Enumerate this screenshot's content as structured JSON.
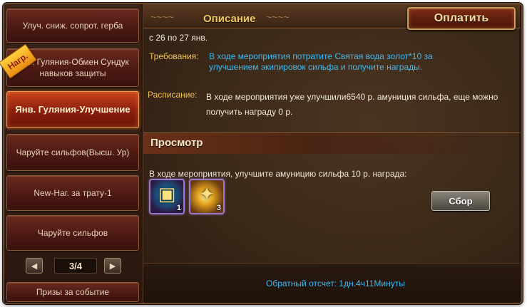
{
  "sidebar": {
    "items": [
      {
        "label": "Улуч. сниж. сопрот. герба"
      },
      {
        "label": "Янв. Гуляния-Обмен Сундук навыков защиты"
      },
      {
        "label": "Янв. Гуляния-Улучшение"
      },
      {
        "label": "Чаруйте сильфов(Высш. Ур)"
      },
      {
        "label": "New-Наг. за трату-1"
      },
      {
        "label": "Чаруйте сильфов"
      },
      {
        "label": "Призы за событие"
      }
    ],
    "badge": "Нагр.",
    "pager": {
      "prev": "◀",
      "next": "▶",
      "count": "3/4"
    }
  },
  "header": {
    "title": "Описание",
    "pay_button": "Оплатить"
  },
  "description": {
    "dates": "с 26 по 27 янв.",
    "requirements_label": "Требования:",
    "requirements_text": "В ходе мероприятия потратите Святая вода золот*10 за улучшением экипировок сильфа  и получите награды.",
    "schedule_label": "Расписание:",
    "schedule_text": "В ходе мероприятия уже улучшили6540 р. амуниция сильфа, еще можно получить награду 0 р."
  },
  "preview": {
    "title": "Просмотр",
    "text": "В ходе мероприятия, улучшите амуницию сильфа 10 р. награда:",
    "rewards": [
      {
        "icon": "treasure-chest-icon",
        "qty": "1"
      },
      {
        "icon": "golden-scroll-icon",
        "qty": "3"
      }
    ],
    "collect_button": "Сбор"
  },
  "footer": {
    "countdown": "Обратный отсчет: 1дн.4ч11Минуты"
  },
  "colors": {
    "accent_gold": "#f0c050",
    "link_blue": "#40b8f0",
    "active_red": "#c8401c"
  }
}
